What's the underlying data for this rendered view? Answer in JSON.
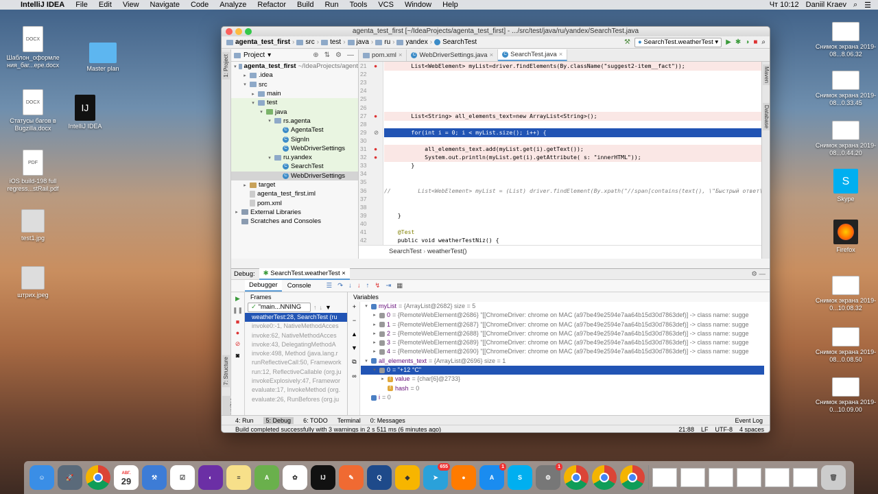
{
  "menubar": {
    "app": "IntelliJ IDEA",
    "items": [
      "File",
      "Edit",
      "View",
      "Navigate",
      "Code",
      "Analyze",
      "Refactor",
      "Build",
      "Run",
      "Tools",
      "VCS",
      "Window",
      "Help"
    ],
    "clock": "Чт 10:12",
    "user": "Daniil Kraev"
  },
  "desktop": {
    "left": [
      {
        "label": "Шаблон_оформле ния_баг...epe.docx",
        "kind": "DOCX"
      },
      {
        "label": "Master plan",
        "kind": "folder"
      },
      {
        "label": "Статусы багов в Bugzilla.docx",
        "kind": "DOCX"
      },
      {
        "label": "IntelliJ IDEA",
        "kind": "app"
      },
      {
        "label": "iOS build-198 full regress...stRail.pdf",
        "kind": "PDF"
      },
      {
        "label": "test1.jpg",
        "kind": "img"
      },
      {
        "label": "штрих.jpeg",
        "kind": "img"
      }
    ],
    "right": [
      {
        "label": "Снимок экрана 2019-08...8.06.32"
      },
      {
        "label": "Снимок экрана 2019-08...0.33.45"
      },
      {
        "label": "Снимок экрана 2019-08...0.44.20"
      },
      {
        "label": "Skype"
      },
      {
        "label": "Firefox"
      },
      {
        "label": "Снимок экрана 2019-0...10.08.32"
      },
      {
        "label": "Снимок экрана 2019-08...0.08.50"
      },
      {
        "label": "Снимок экрана 2019-0...10.09.00"
      }
    ]
  },
  "window": {
    "title": "agenta_test_first [~/IdeaProjects/agenta_test_first] - .../src/test/java/ru/yandex/SearchTest.java",
    "breadcrumbs": [
      "agenta_test_first",
      "src",
      "test",
      "java",
      "ru",
      "yandex",
      "SearchTest"
    ],
    "run_config": "SearchTest.weatherTest"
  },
  "project": {
    "header": "Project",
    "tree": [
      {
        "text": "agenta_test_first",
        "muted": "~/IdeaProjects/agent",
        "depth": 0,
        "arrow": "▾",
        "icon": "folder",
        "bold": true
      },
      {
        "text": ".idea",
        "depth": 1,
        "arrow": "▸",
        "icon": "folder"
      },
      {
        "text": "src",
        "depth": 1,
        "arrow": "▾",
        "icon": "folder"
      },
      {
        "text": "main",
        "depth": 2,
        "arrow": "▸",
        "icon": "folder"
      },
      {
        "text": "test",
        "depth": 2,
        "arrow": "▾",
        "icon": "folder"
      },
      {
        "text": "java",
        "depth": 3,
        "arrow": "▾",
        "icon": "gfolder"
      },
      {
        "text": "rs.agenta",
        "depth": 4,
        "arrow": "▾",
        "icon": "folder"
      },
      {
        "text": "AgentaTest",
        "depth": 5,
        "arrow": "",
        "icon": "class"
      },
      {
        "text": "SignIn",
        "depth": 5,
        "arrow": "",
        "icon": "class"
      },
      {
        "text": "WebDriverSettings",
        "depth": 5,
        "arrow": "",
        "icon": "class"
      },
      {
        "text": "ru.yandex",
        "depth": 4,
        "arrow": "▾",
        "icon": "folder"
      },
      {
        "text": "SearchTest",
        "depth": 5,
        "arrow": "",
        "icon": "class"
      },
      {
        "text": "WebDriverSettings",
        "depth": 5,
        "arrow": "",
        "icon": "class",
        "selected": true
      },
      {
        "text": "target",
        "depth": 1,
        "arrow": "▸",
        "icon": "ofolder"
      },
      {
        "text": "agenta_test_first.iml",
        "depth": 1,
        "arrow": "",
        "icon": "file"
      },
      {
        "text": "pom.xml",
        "depth": 1,
        "arrow": "",
        "icon": "file"
      },
      {
        "text": "External Libraries",
        "depth": 0,
        "arrow": "▸",
        "icon": "lib"
      },
      {
        "text": "Scratches and Consoles",
        "depth": 0,
        "arrow": "",
        "icon": "lib"
      }
    ]
  },
  "editor": {
    "tabs": [
      "pom.xml",
      "WebDriverSettings.java",
      "SearchTest.java"
    ],
    "lines": [
      {
        "n": "21",
        "hl": "red",
        "code": "        List<WebElement> myList=driver.findElements(By.className(\"suggest2-item__fact\"));"
      },
      {
        "n": "22",
        "hl": "",
        "code": ""
      },
      {
        "n": "23",
        "hl": "",
        "code": ""
      },
      {
        "n": "24",
        "hl": "",
        "code": ""
      },
      {
        "n": "25",
        "hl": "",
        "code": ""
      },
      {
        "n": "26",
        "hl": "",
        "code": ""
      },
      {
        "n": "27",
        "hl": "red",
        "code": "        List<String> all_elements_text=new ArrayList<String>();"
      },
      {
        "n": "28",
        "hl": "",
        "code": ""
      },
      {
        "n": "29",
        "hl": "blue",
        "code": "        for(int i = 0; i < myList.size(); i++) {"
      },
      {
        "n": "30",
        "hl": "",
        "code": ""
      },
      {
        "n": "31",
        "hl": "red",
        "code": "            all_elements_text.add(myList.get(i).getText());"
      },
      {
        "n": "32",
        "hl": "red",
        "code": "            System.out.println(myList.get(i).getAttribute( s: \"innerHTML\"));"
      },
      {
        "n": "33",
        "hl": "",
        "code": "        }"
      },
      {
        "n": "34",
        "hl": "",
        "code": ""
      },
      {
        "n": "35",
        "hl": "",
        "code": ""
      },
      {
        "n": "36",
        "hl": "cm",
        "code": "//        List<WebElement> myList = (List) driver.findElement(By.xpath(\"//span[contains(text(), \\\"Быстрый ответ\\\")][0]."
      },
      {
        "n": "37",
        "hl": "",
        "code": ""
      },
      {
        "n": "38",
        "hl": "",
        "code": ""
      },
      {
        "n": "39",
        "hl": "",
        "code": "    }"
      },
      {
        "n": "40",
        "hl": "",
        "code": ""
      },
      {
        "n": "41",
        "hl": "ann",
        "code": "    @Test"
      },
      {
        "n": "42",
        "hl": "",
        "code": "    public void weatherTestNiz() {"
      }
    ],
    "status": [
      "SearchTest",
      "weatherTest()"
    ],
    "right_tabs": [
      "Maven",
      "Database"
    ]
  },
  "debug": {
    "label": "Debug:",
    "session": "SearchTest.weatherTest",
    "tabs": [
      "Debugger",
      "Console"
    ],
    "frames_label": "Frames",
    "thread": "\"main...NNING",
    "variables_label": "Variables",
    "frames": [
      "weatherTest:28, SearchTest (ru",
      "invoke0:-1, NativeMethodAcces",
      "invoke:62, NativeMethodAcces",
      "invoke:43, DelegatingMethodA",
      "invoke:498, Method (java.lang.r",
      "runReflectiveCall:50, Framework",
      "run:12, ReflectiveCallable (org.ju",
      "invokeExplosively:47, Framewor",
      "evaluate:17, InvokeMethod (org.",
      "evaluate:26, RunBefores (org.ju"
    ],
    "vars": [
      {
        "d": 0,
        "a": "▾",
        "i": "b",
        "name": "myList",
        "val": " = {ArrayList@2682}  size = 5"
      },
      {
        "d": 1,
        "a": "▸",
        "i": "",
        "name": "0",
        "val": " = {RemoteWebElement@2686} \"[[ChromeDriver: chrome on MAC (a97be49e2594e7aa64b15d30d7863def)] -> class name: sugge"
      },
      {
        "d": 1,
        "a": "▸",
        "i": "",
        "name": "1",
        "val": " = {RemoteWebElement@2687} \"[[ChromeDriver: chrome on MAC (a97be49e2594e7aa64b15d30d7863def)] -> class name: sugge"
      },
      {
        "d": 1,
        "a": "▸",
        "i": "",
        "name": "2",
        "val": " = {RemoteWebElement@2688} \"[[ChromeDriver: chrome on MAC (a97be49e2594e7aa64b15d30d7863def)] -> class name: sugge"
      },
      {
        "d": 1,
        "a": "▸",
        "i": "",
        "name": "3",
        "val": " = {RemoteWebElement@2689} \"[[ChromeDriver: chrome on MAC (a97be49e2594e7aa64b15d30d7863def)] -> class name: sugge"
      },
      {
        "d": 1,
        "a": "▸",
        "i": "",
        "name": "4",
        "val": " = {RemoteWebElement@2690} \"[[ChromeDriver: chrome on MAC (a97be49e2594e7aa64b15d30d7863def)] -> class name: sugge"
      },
      {
        "d": 0,
        "a": "▾",
        "i": "b",
        "name": "all_elements_text",
        "val": " = {ArrayList@2696}  size = 1"
      },
      {
        "d": 1,
        "a": "▾",
        "i": "",
        "name": "0",
        "val": " = \"+12 °C\"",
        "sel": true
      },
      {
        "d": 2,
        "a": "▸",
        "i": "f",
        "name": "value",
        "val": " = {char[6]@2733}"
      },
      {
        "d": 2,
        "a": "",
        "i": "f",
        "name": "hash",
        "val": " = 0"
      },
      {
        "d": 0,
        "a": "",
        "i": "b",
        "name": "i",
        "val": " = 0"
      }
    ]
  },
  "bottom": {
    "tools": [
      "4: Run",
      "5: Debug",
      "6: TODO",
      "Terminal",
      "0: Messages"
    ],
    "event_log": "Event Log",
    "status": "Build completed successfully with 3 warnings in 2 s 511 ms (6 minutes ago)",
    "pos": "21:88",
    "lf": "LF",
    "enc": "UTF-8",
    "indent": "4 spaces"
  },
  "dock": {
    "badges": {
      "appstore": "1",
      "telegram": "655",
      "system": "1"
    },
    "calendar_day": "29",
    "calendar_month": "АВГ."
  }
}
